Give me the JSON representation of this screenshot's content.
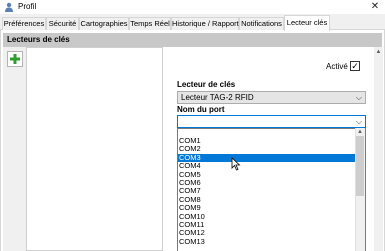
{
  "window": {
    "title": "Profil",
    "close_glyph": "✕"
  },
  "tabs": [
    {
      "label": "Préférences"
    },
    {
      "label": "Sécurité"
    },
    {
      "label": "Cartographies"
    },
    {
      "label": "Temps Réel"
    },
    {
      "label": "Historique / Rapport"
    },
    {
      "label": "Notifications"
    },
    {
      "label": "Lecteur clés"
    }
  ],
  "active_tab": "Lecteur clés",
  "section": {
    "title": "Lecteurs de clés"
  },
  "toolbar": {
    "add_icon": "plus-icon",
    "add_color": "#2e9e2e"
  },
  "form": {
    "active_label": "Activé",
    "active_checked": true,
    "check_glyph": "✓",
    "reader_label": "Lecteur de clés",
    "reader_value": "Lecteur TAG-2 RFID",
    "port_label": "Nom du port",
    "port_value": "",
    "chevron_glyph": "⌵"
  },
  "port_options": [
    "COM1",
    "COM2",
    "COM3",
    "COM4",
    "COM5",
    "COM6",
    "COM7",
    "COM8",
    "COM9",
    "COM10",
    "COM11",
    "COM12",
    "COM13"
  ],
  "port_selected": "COM3",
  "scroll_up_glyph": "▲",
  "colors": {
    "accent": "#0078d7",
    "header_bg": "#c8c8c8"
  }
}
